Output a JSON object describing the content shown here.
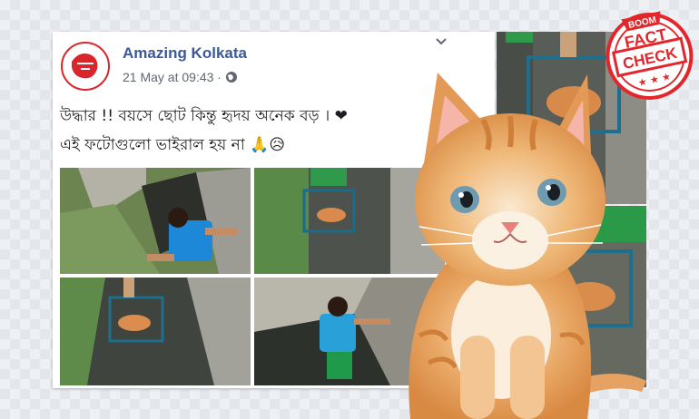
{
  "post": {
    "page_name": "Amazing Kolkata",
    "timestamp": "21 May at 09:43 ·",
    "privacy_icon": "globe-icon",
    "more_icon": "ellipsis-icon",
    "text_line1": "উদ্ধার !! বয়সে ছোট কিন্তু হৃদয় অনেক বড় । ❤",
    "text_line2": "এই ফটোগুলো ভাইরাল হয় না 🙏😥"
  },
  "badge": {
    "top_text": "BOOM",
    "line1": "FACT",
    "line2": "CHECK",
    "stars": "★ ★ ★",
    "color": "#e3262b"
  },
  "colors": {
    "link": "#3b5998",
    "heart": "#e0245e"
  }
}
